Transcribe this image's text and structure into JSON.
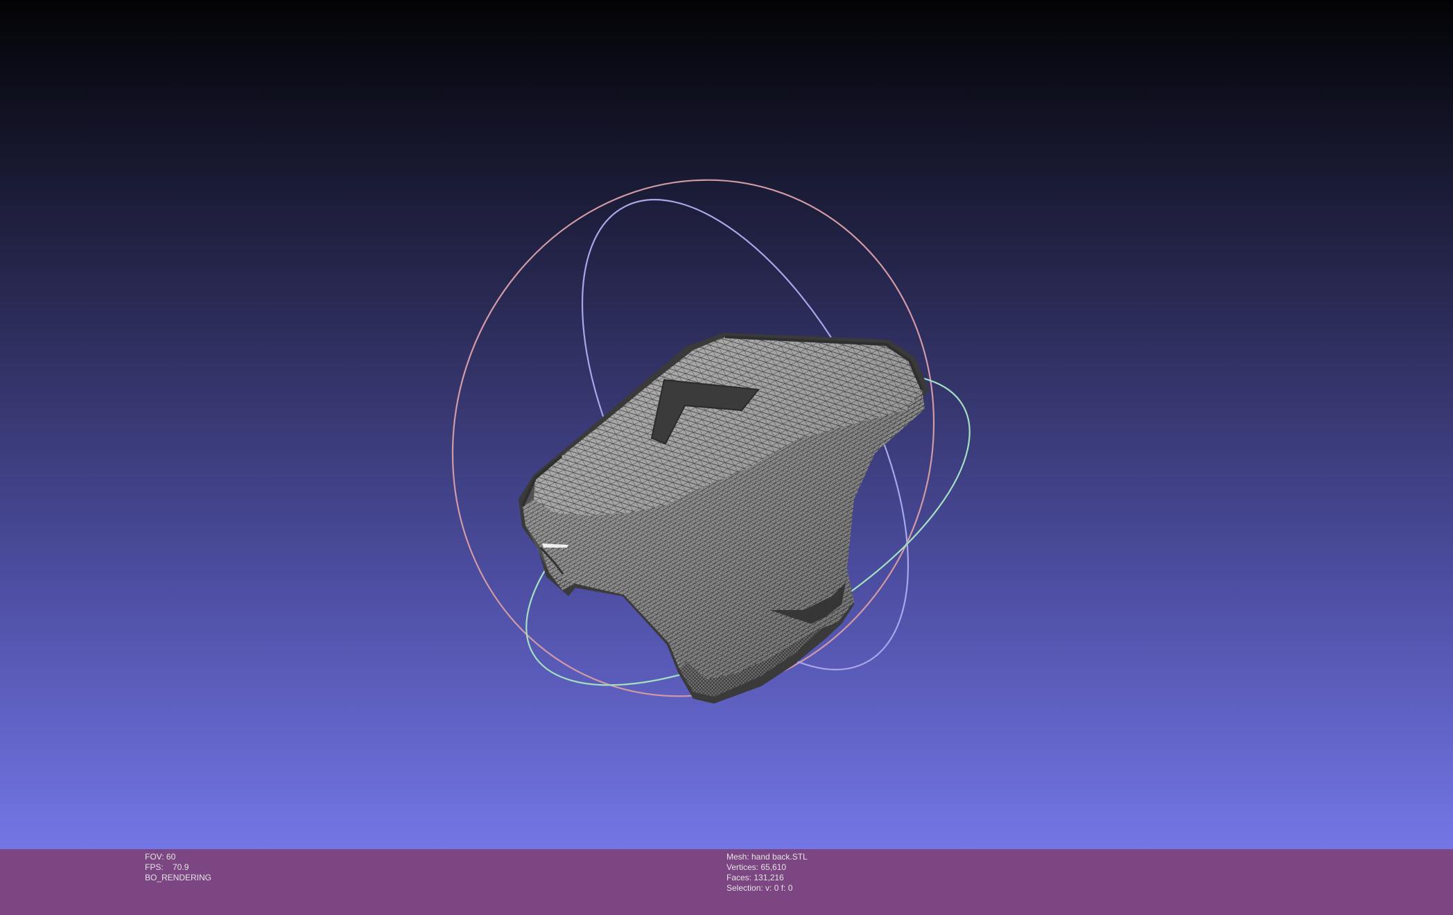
{
  "viewer": {
    "left_panel": {
      "fov_label": "FOV: 60",
      "fps_label": "FPS:    70.9",
      "render_mode": "BO_RENDERING"
    },
    "right_panel": {
      "mesh_label": "Mesh: hand back.STL",
      "vertices_label": "Vertices: 65,610",
      "faces_label": "Faces: 131,216",
      "selection_label": "Selection: v: 0 f: 0"
    }
  },
  "colors": {
    "infobar_background": "#7c4683",
    "mesh_fill": "#9a9a9a",
    "mesh_wire": "#2b2b2b",
    "trackball_x": "#d49aa0",
    "trackball_y": "#a9e6c0",
    "trackball_z": "#b9b4f2"
  },
  "icons": {
    "trackball": "trackball-rings-icon",
    "mesh": "wireframe-mesh-icon"
  }
}
